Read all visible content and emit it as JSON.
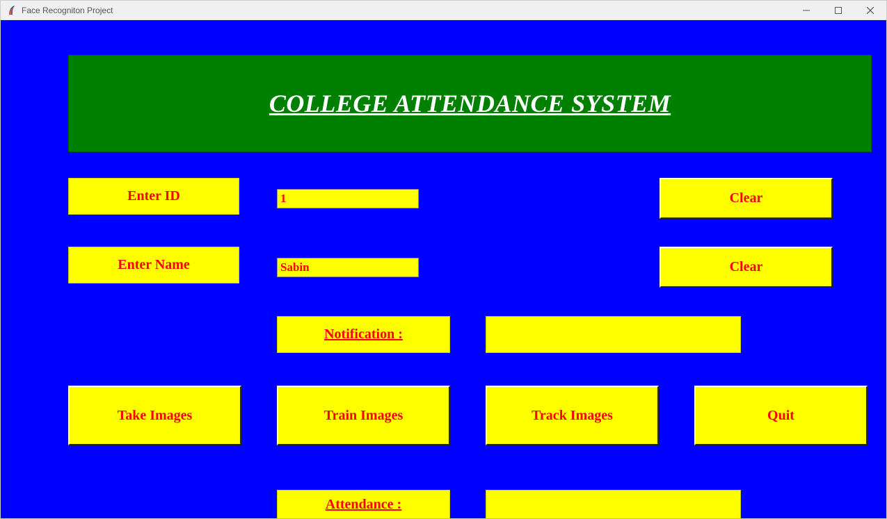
{
  "window": {
    "title": "Face Recogniton Project"
  },
  "banner": {
    "title": "COLLEGE ATTENDANCE SYSTEM"
  },
  "form": {
    "id_label": "Enter ID",
    "id_value": "1",
    "name_label": "Enter Name",
    "name_value": "Sabin",
    "clear_label": "Clear"
  },
  "notification": {
    "label": "Notification : ",
    "value": ""
  },
  "actions": {
    "take_images": "Take Images",
    "train_images": "Train Images",
    "track_images": "Track Images",
    "quit": "Quit"
  },
  "attendance": {
    "label": "Attendance : ",
    "value": ""
  }
}
